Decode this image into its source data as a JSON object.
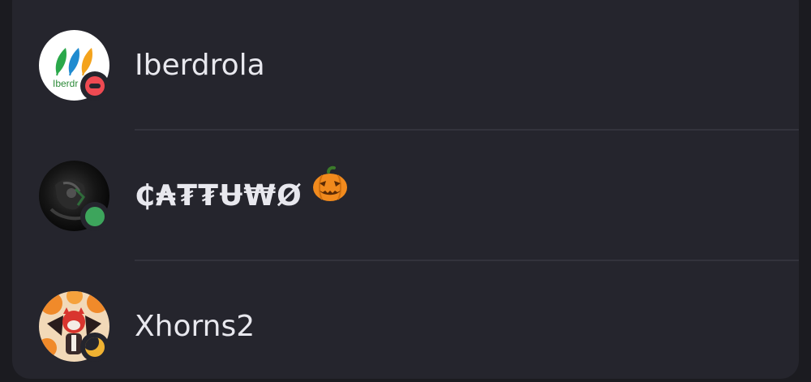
{
  "members": [
    {
      "name": "Iberdrola",
      "avatar_text": "Iberdr",
      "status": "dnd",
      "status_icon": "do-not-disturb-icon"
    },
    {
      "name": "₵₳₮₮Ʉ₩Ø",
      "emoji": "jack-o-lantern-icon",
      "status": "online",
      "status_icon": "online-status-icon"
    },
    {
      "name": "Xhorns2",
      "status": "idle",
      "status_icon": "idle-moon-icon"
    }
  ],
  "colors": {
    "background": "#25252d",
    "divider": "#33333c",
    "text": "#e8e8ee",
    "dnd": "#ef4a52",
    "online": "#3da55c",
    "idle": "#f0b232"
  }
}
